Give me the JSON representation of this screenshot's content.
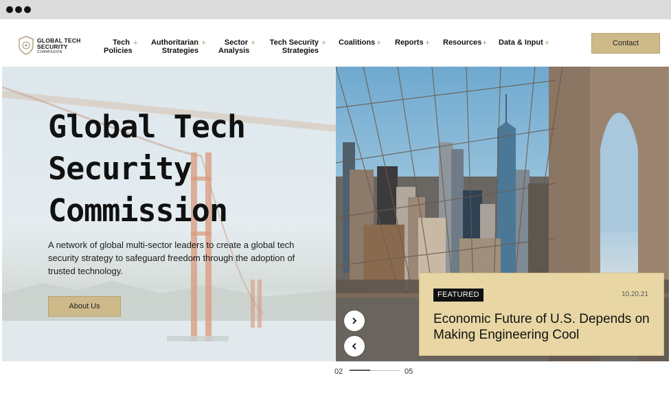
{
  "header": {
    "logo": {
      "line1": "GLOBAL TECH SECURITY",
      "line2": "COMMISSION"
    },
    "nav": [
      {
        "label": "Tech Policies"
      },
      {
        "label": "Authoritarian Strategies"
      },
      {
        "label": "Sector Analysis"
      },
      {
        "label": "Tech Security Strategies"
      },
      {
        "label": "Coalitions"
      },
      {
        "label": "Reports"
      },
      {
        "label": "Resources"
      },
      {
        "label": "Data & Input"
      }
    ],
    "contact_label": "Contact"
  },
  "hero": {
    "title": "Global Tech Security Commission",
    "subtitle": "A network of global multi-sector leaders to create a global tech security strategy to safeguard freedom through the adoption of trusted technology.",
    "about_label": "About Us"
  },
  "featured": {
    "badge": "FEATURED",
    "date": "10.20.21",
    "title": "Economic Future of U.S. Depends on Making Engineering Cool"
  },
  "carousel": {
    "current": "02",
    "total": "05",
    "progress": 0.4
  },
  "colors": {
    "accent": "#cdb98a",
    "card": "#e8d7a4",
    "plus": "#b8a77a"
  }
}
